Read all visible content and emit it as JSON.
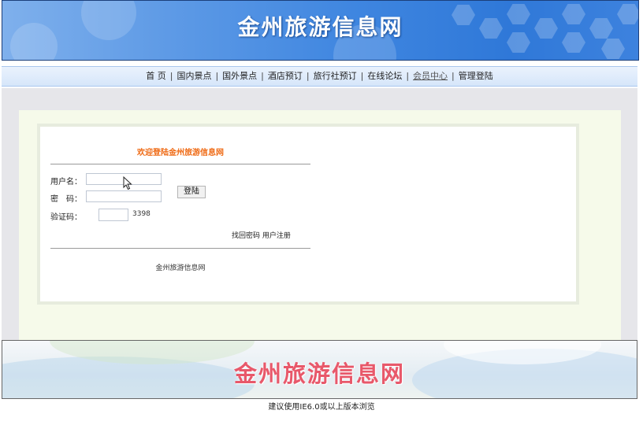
{
  "header": {
    "title": "金州旅游信息网"
  },
  "nav": {
    "items": [
      {
        "label": "首 页",
        "active": false
      },
      {
        "label": "国内景点",
        "active": false
      },
      {
        "label": "国外景点",
        "active": false
      },
      {
        "label": "酒店预订",
        "active": false
      },
      {
        "label": "旅行社预订",
        "active": false
      },
      {
        "label": "在线论坛",
        "active": false
      },
      {
        "label": "会员中心",
        "active": true
      },
      {
        "label": "管理登陆",
        "active": false
      }
    ],
    "separator": "|"
  },
  "login": {
    "welcome": "欢迎登陆金州旅游信息网",
    "username_label": "用户名：",
    "username_value": "",
    "password_label": "密　码：",
    "password_value": "",
    "captcha_label": "验证码：",
    "captcha_value": "",
    "captcha_code": "3398",
    "submit_label": "登陆",
    "forgot_password": "找回密码",
    "register": "用户注册",
    "site_name": "金州旅游信息网"
  },
  "footer": {
    "title": "金州旅游信息网",
    "note": "建议使用IE6.0或以上版本浏览"
  },
  "colors": {
    "header_blue": "#3f86e0",
    "welcome_orange": "#ef6a14",
    "footer_title": "#e8586a"
  }
}
